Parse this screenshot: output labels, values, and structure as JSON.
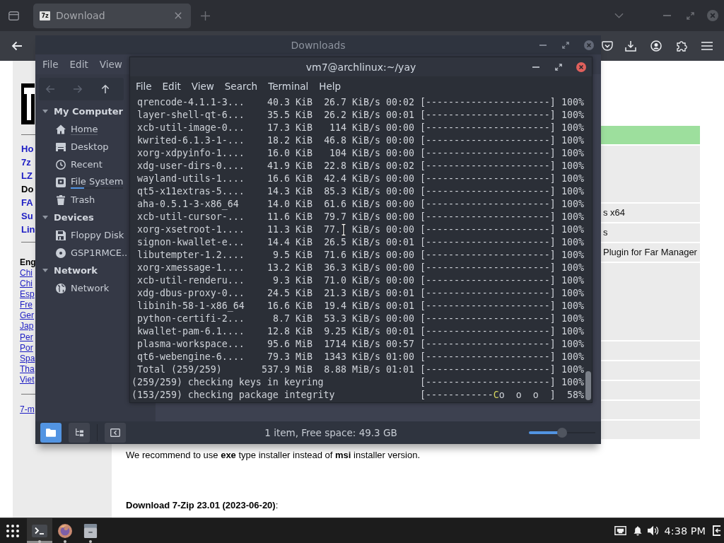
{
  "browser": {
    "tabs": [
      {
        "title": "Download",
        "favicon": "7z",
        "selected": true
      }
    ],
    "page": {
      "nav_links": [
        {
          "text": "Ho",
          "selected": false
        },
        {
          "text": "7z",
          "selected": false
        },
        {
          "text": "LZ",
          "selected": false
        },
        {
          "text": "Do",
          "selected": true
        },
        {
          "text": "FA",
          "selected": false
        },
        {
          "text": "Su",
          "selected": false
        },
        {
          "text": "Lin",
          "selected": false
        }
      ],
      "language_links": [
        {
          "text": "Eng",
          "selected": true
        },
        {
          "text": "Chi",
          "selected": false
        },
        {
          "text": "Chi",
          "selected": false
        },
        {
          "text": "Esp",
          "selected": false
        },
        {
          "text": "Fre",
          "selected": false
        },
        {
          "text": "Ger",
          "selected": false
        },
        {
          "text": "Jap",
          "selected": false
        },
        {
          "text": "Per",
          "selected": false
        },
        {
          "text": "Por",
          "selected": false
        },
        {
          "text": "Spa",
          "selected": false
        },
        {
          "text": "Tha",
          "selected": false
        },
        {
          "text": "Viet",
          "selected": false
        }
      ],
      "footer_link": "7-m",
      "table_rows": [
        {
          "text": "s x64"
        },
        {
          "text": "s"
        },
        {
          "text": "Plugin for Far Manager"
        }
      ],
      "note": "We recommend to use **exe** type installer instead of **msi** installer version.",
      "download_heading": "**Download 7-Zip 23.01 (2023-06-20)**:"
    }
  },
  "file_manager": {
    "title": "Downloads",
    "focused": false,
    "menu": [
      "File",
      "Edit",
      "View"
    ],
    "nav_buttons": [
      {
        "kind": "back",
        "disabled": true
      },
      {
        "kind": "forward",
        "disabled": true
      },
      {
        "kind": "up",
        "disabled": false
      }
    ],
    "sidebar": [
      {
        "label": "My Computer",
        "expanded": true,
        "children": [
          {
            "label": "Home",
            "kind": "home"
          },
          {
            "label": "Desktop",
            "kind": "desktop"
          },
          {
            "label": "Recent",
            "kind": "recent"
          },
          {
            "label": "File System",
            "kind": "drive",
            "level": 0.25
          },
          {
            "label": "Trash",
            "kind": "trash"
          }
        ]
      },
      {
        "label": "Devices",
        "expanded": true,
        "children": [
          {
            "label": "Floppy Disk",
            "kind": "floppy"
          },
          {
            "label": "GSP1RMCE..",
            "kind": "disc"
          }
        ]
      },
      {
        "label": "Network",
        "expanded": true,
        "children": [
          {
            "label": "Network",
            "kind": "network"
          }
        ]
      }
    ],
    "view_buttons": [
      {
        "kind": "icons",
        "selected": true
      },
      {
        "kind": "tree",
        "selected": false
      }
    ],
    "status": "1 item, Free space: 49.3 GB",
    "zoom": {
      "level": 0.5
    }
  },
  "terminal": {
    "title": "vm7@archlinux:~/yay",
    "focused": true,
    "menu": [
      "File",
      "Edit",
      "View",
      "Search",
      "Terminal",
      "Help"
    ],
    "lines": [
      {
        "kind": "package",
        "name": "qrencode-4.1.1-3...",
        "size": "40.3 KiB",
        "rate": "26.7 KiB/s",
        "time": "00:02",
        "bar": "[----------------------]",
        "percent": "100%"
      },
      {
        "kind": "package",
        "name": "layer-shell-qt-6...",
        "size": "35.5 KiB",
        "rate": "26.2 KiB/s",
        "time": "00:01",
        "bar": "[----------------------]",
        "percent": "100%"
      },
      {
        "kind": "package",
        "name": "xcb-util-image-0...",
        "size": "17.3 KiB",
        "rate": "114 KiB/s",
        "time": "00:00",
        "bar": "[----------------------]",
        "percent": "100%"
      },
      {
        "kind": "package",
        "name": "kwrited-6.1.3-1-...",
        "size": "18.2 KiB",
        "rate": "46.8 KiB/s",
        "time": "00:00",
        "bar": "[----------------------]",
        "percent": "100%"
      },
      {
        "kind": "package",
        "name": "xorg-xdpyinfo-1....",
        "size": "16.0 KiB",
        "rate": "104 KiB/s",
        "time": "00:00",
        "bar": "[----------------------]",
        "percent": "100%"
      },
      {
        "kind": "package",
        "name": "xdg-user-dirs-0....",
        "size": "41.9 KiB",
        "rate": "22.8 KiB/s",
        "time": "00:02",
        "bar": "[----------------------]",
        "percent": "100%"
      },
      {
        "kind": "package",
        "name": "wayland-utils-1....",
        "size": "16.6 KiB",
        "rate": "42.4 KiB/s",
        "time": "00:00",
        "bar": "[----------------------]",
        "percent": "100%"
      },
      {
        "kind": "package",
        "name": "qt5-x11extras-5....",
        "size": "14.3 KiB",
        "rate": "85.3 KiB/s",
        "time": "00:00",
        "bar": "[----------------------]",
        "percent": "100%"
      },
      {
        "kind": "package",
        "name": "aha-0.5.1-3-x86_64",
        "size": "14.0 KiB",
        "rate": "61.6 KiB/s",
        "time": "00:00",
        "bar": "[----------------------]",
        "percent": "100%"
      },
      {
        "kind": "package",
        "name": "xcb-util-cursor-...",
        "size": "11.6 KiB",
        "rate": "79.7 KiB/s",
        "time": "00:00",
        "bar": "[----------------------]",
        "percent": "100%"
      },
      {
        "kind": "package",
        "name": "xorg-xsetroot-1....",
        "size": "11.3 KiB",
        "rate": "77.",
        "pointer": true,
        "rate_unit": "KiB/s",
        "time": "00:00",
        "bar": "[----------------------]",
        "percent": "100%"
      },
      {
        "kind": "package",
        "name": "signon-kwallet-e...",
        "size": "14.4 KiB",
        "rate": "26.5 KiB/s",
        "time": "00:01",
        "bar": "[----------------------]",
        "percent": "100%"
      },
      {
        "kind": "package",
        "name": "libutempter-1.2....",
        "size": "9.5 KiB",
        "rate": "71.6 KiB/s",
        "time": "00:00",
        "bar": "[----------------------]",
        "percent": "100%"
      },
      {
        "kind": "package",
        "name": "xorg-xmessage-1....",
        "size": "13.2 KiB",
        "rate": "36.3 KiB/s",
        "time": "00:00",
        "bar": "[----------------------]",
        "percent": "100%"
      },
      {
        "kind": "package",
        "name": "xcb-util-renderu...",
        "size": "9.3 KiB",
        "rate": "71.0 KiB/s",
        "time": "00:00",
        "bar": "[----------------------]",
        "percent": "100%"
      },
      {
        "kind": "package",
        "name": "xdg-dbus-proxy-0...",
        "size": "24.5 KiB",
        "rate": "21.3 KiB/s",
        "time": "00:01",
        "bar": "[----------------------]",
        "percent": "100%"
      },
      {
        "kind": "package",
        "name": "libinih-58-1-x86_64",
        "size": "16.6 KiB",
        "rate": "19.4 KiB/s",
        "time": "00:01",
        "bar": "[----------------------]",
        "percent": "100%"
      },
      {
        "kind": "package",
        "name": "python-certifi-2...",
        "size": "8.7 KiB",
        "rate": "53.3 KiB/s",
        "time": "00:00",
        "bar": "[----------------------]",
        "percent": "100%"
      },
      {
        "kind": "package",
        "name": "kwallet-pam-6.1....",
        "size": "12.8 KiB",
        "rate": "9.25 KiB/s",
        "time": "00:01",
        "bar": "[----------------------]",
        "percent": "100%"
      },
      {
        "kind": "package",
        "name": "plasma-workspace...",
        "size": "95.6 MiB",
        "rate": "1714 KiB/s",
        "time": "00:57",
        "bar": "[----------------------]",
        "percent": "100%"
      },
      {
        "kind": "package",
        "name": "qt6-webengine-6....",
        "size": "79.3 MiB",
        "rate": "1343 KiB/s",
        "time": "01:00",
        "bar": "[----------------------]",
        "percent": "100%"
      },
      {
        "kind": "total",
        "name": "Total (259/259)",
        "size": "537.9 MiB",
        "rate": "8.88 MiB/s",
        "time": "01:01",
        "bar": "[----------------------]",
        "percent": "100%"
      },
      {
        "kind": "step",
        "text": "(259/259) checking keys in keyring",
        "bar": "[----------------------]",
        "percent": "100%"
      },
      {
        "kind": "step",
        "text": "(153/259) checking package integrity",
        "bar": "[------------",
        "pacman": "C",
        "bar_rest": "o  o  o  ]",
        "percent": "58%"
      }
    ]
  },
  "taskbar": {
    "apps": [
      {
        "kind": "terminal",
        "selected": true,
        "running": true
      },
      {
        "kind": "browser",
        "selected": false,
        "running": true
      },
      {
        "kind": "files",
        "selected": false,
        "running": true
      }
    ],
    "clock": "4:38 PM"
  }
}
